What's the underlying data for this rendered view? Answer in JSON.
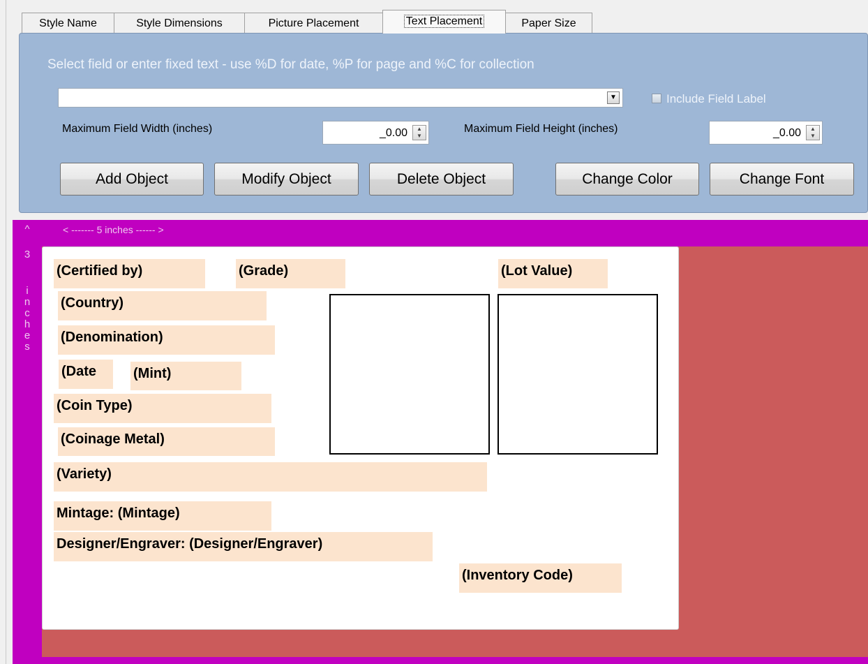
{
  "tabs": [
    {
      "label": "Style Name"
    },
    {
      "label": "Style Dimensions"
    },
    {
      "label": "Picture Placement"
    },
    {
      "label": "Text Placement",
      "active": true
    },
    {
      "label": "Paper Size"
    }
  ],
  "panel": {
    "instruction": "Select field or enter fixed text - use %D for date, %P for page and %C for collection",
    "field_value": "",
    "include_field_label": "Include Field Label",
    "include_field_label_checked": false,
    "max_width_label": "Maximum Field Width (inches)",
    "max_width_value": "_0.00",
    "max_height_label": "Maximum Field Height (inches)",
    "max_height_value": "_0.00",
    "buttons": {
      "add": "Add Object",
      "modify": "Modify Object",
      "delete": "Delete Object",
      "color": "Change Color",
      "font": "Change Font"
    }
  },
  "design": {
    "horizontal_ruler": "< ------- 5 inches ------ >",
    "vertical_ruler": [
      "^",
      "3",
      "",
      "i",
      "n",
      "c",
      "h",
      "e",
      "s"
    ],
    "fields": {
      "certified_by": "(Certified by)",
      "grade": "(Grade)",
      "lot_value": "(Lot Value)",
      "country": "(Country)",
      "denomination": "(Denomination)",
      "date": "(Date",
      "mint": "(Mint)",
      "coin_type": "(Coin Type)",
      "coinage_metal": "(Coinage Metal)",
      "variety": "(Variety)",
      "mintage": "Mintage: (Mintage)",
      "designer": "Designer/Engraver: (Designer/Engraver)",
      "inventory_code": "(Inventory Code)"
    }
  },
  "colors": {
    "panel": "#9eb7d6",
    "design_border": "#c000c0",
    "background_area": "#cb5b5b",
    "field_highlight": "#fce4ce"
  }
}
